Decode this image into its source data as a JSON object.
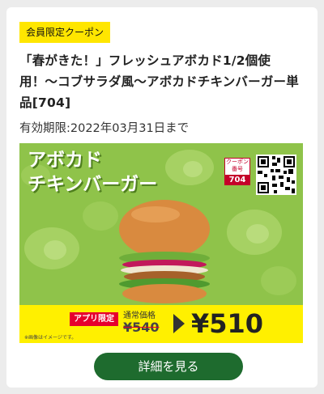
{
  "coupon": {
    "badge": "会員限定クーポン",
    "title": "「春がきた！」フレッシュアボカド1/2個使用！〜コブサラダ風〜アボカドチキンバーガー単品[704]",
    "expiry": "有効期限:2022年03月31日まで",
    "banner": {
      "product_name_line1": "アボカド",
      "product_name_line2": "チキンバーガー",
      "coupon_no_label": "クーポン番号",
      "coupon_no": "704",
      "app_only": "アプリ限定",
      "regular_label": "通常価格",
      "regular_price": "¥540",
      "app_price": "¥510",
      "note": "※画像はイメージです。"
    },
    "detail_button": "詳細を見る"
  },
  "colors": {
    "badge": "#ffe600",
    "banner_bg": "#8fc34a",
    "price_bar": "#fff000",
    "accent_red": "#e6002d",
    "button": "#1e6b2e"
  }
}
